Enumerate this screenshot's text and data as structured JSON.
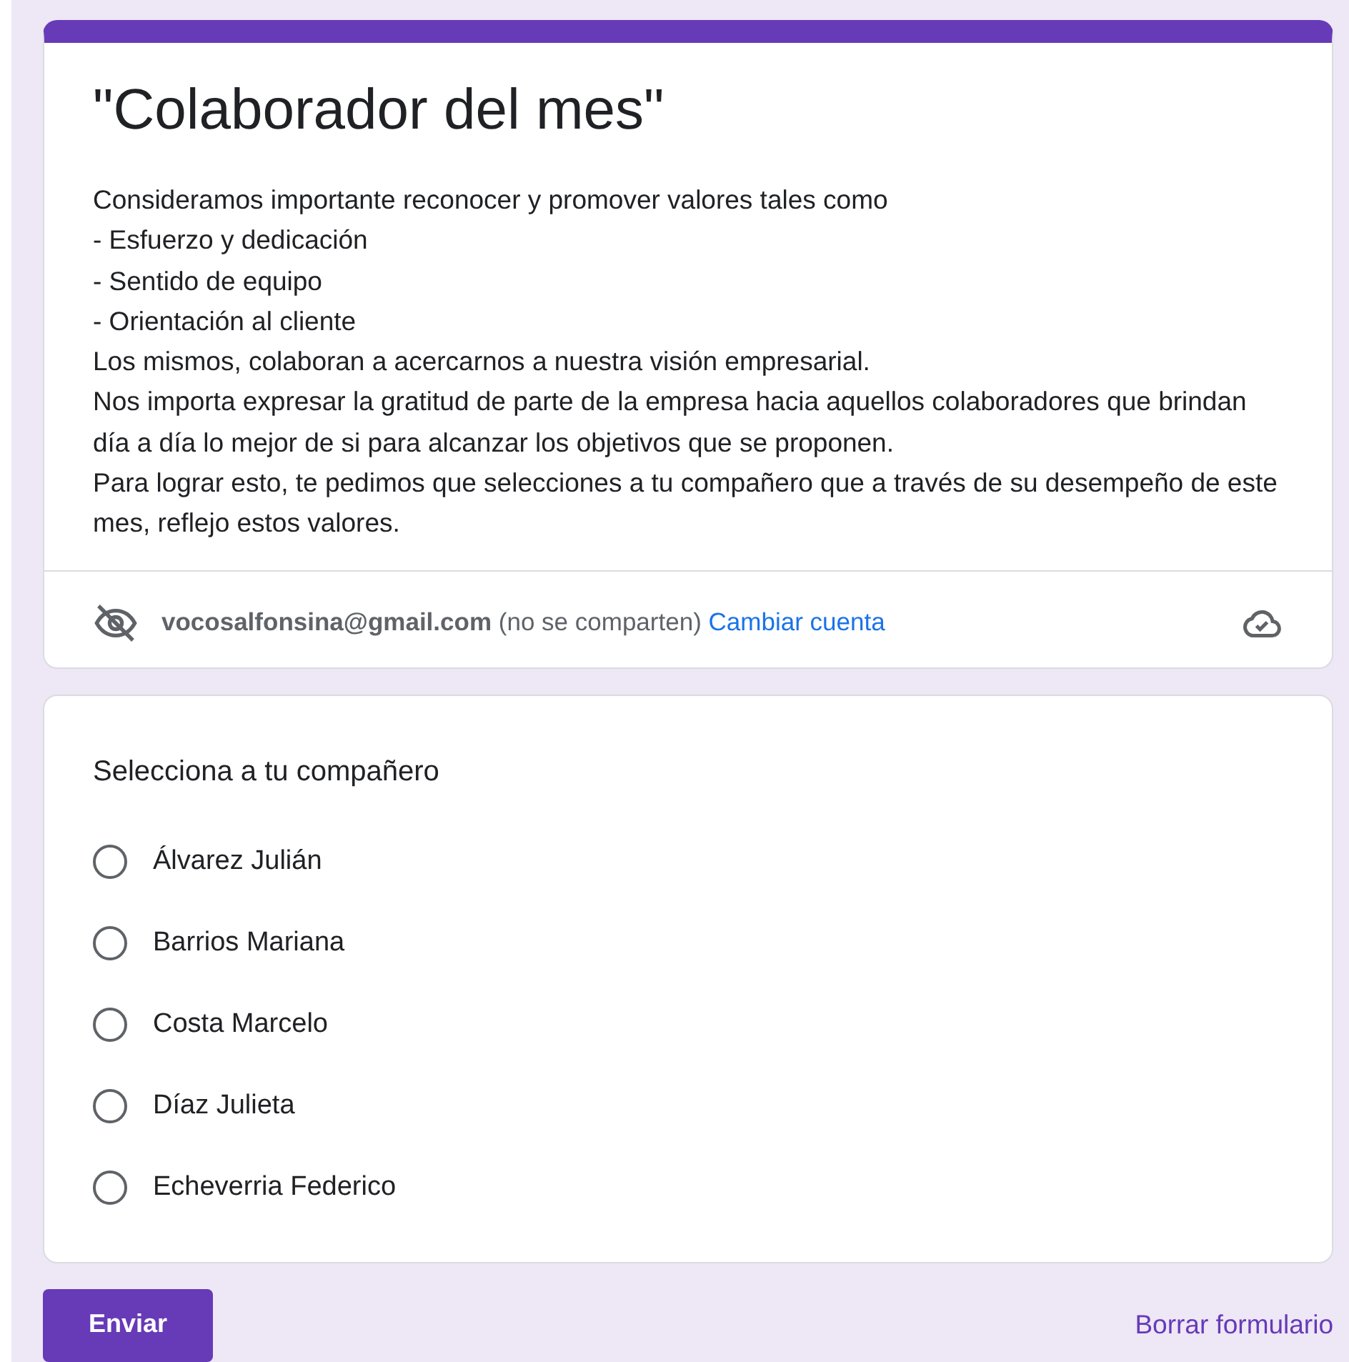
{
  "form": {
    "title": "\"Colaborador del mes\"",
    "description": [
      "Consideramos importante reconocer y promover valores tales como",
      "- Esfuerzo y dedicación",
      "- Sentido de equipo",
      "- Orientación al cliente",
      "Los mismos, colaboran a acercarnos a nuestra visión empresarial.",
      "Nos importa expresar la gratitud de parte de la empresa hacia aquellos colaboradores que brindan día a día lo mejor de si para alcanzar los objetivos que se proponen.",
      "Para lograr esto, te pedimos que selecciones a tu compañero que a través de su desempeño de este mes, reflejo estos valores."
    ],
    "account": {
      "email": "vocosalfonsina@gmail.com",
      "note": "(no se comparten)",
      "switch_link": "Cambiar cuenta"
    }
  },
  "question": {
    "title": "Selecciona a tu compañero",
    "options": [
      {
        "label": "Álvarez Julián",
        "selected": false
      },
      {
        "label": "Barrios Mariana",
        "selected": false
      },
      {
        "label": "Costa Marcelo",
        "selected": false
      },
      {
        "label": "Díaz Julieta",
        "selected": false
      },
      {
        "label": "Echeverria Federico",
        "selected": false
      }
    ]
  },
  "actions": {
    "submit": "Enviar",
    "clear": "Borrar formulario"
  }
}
